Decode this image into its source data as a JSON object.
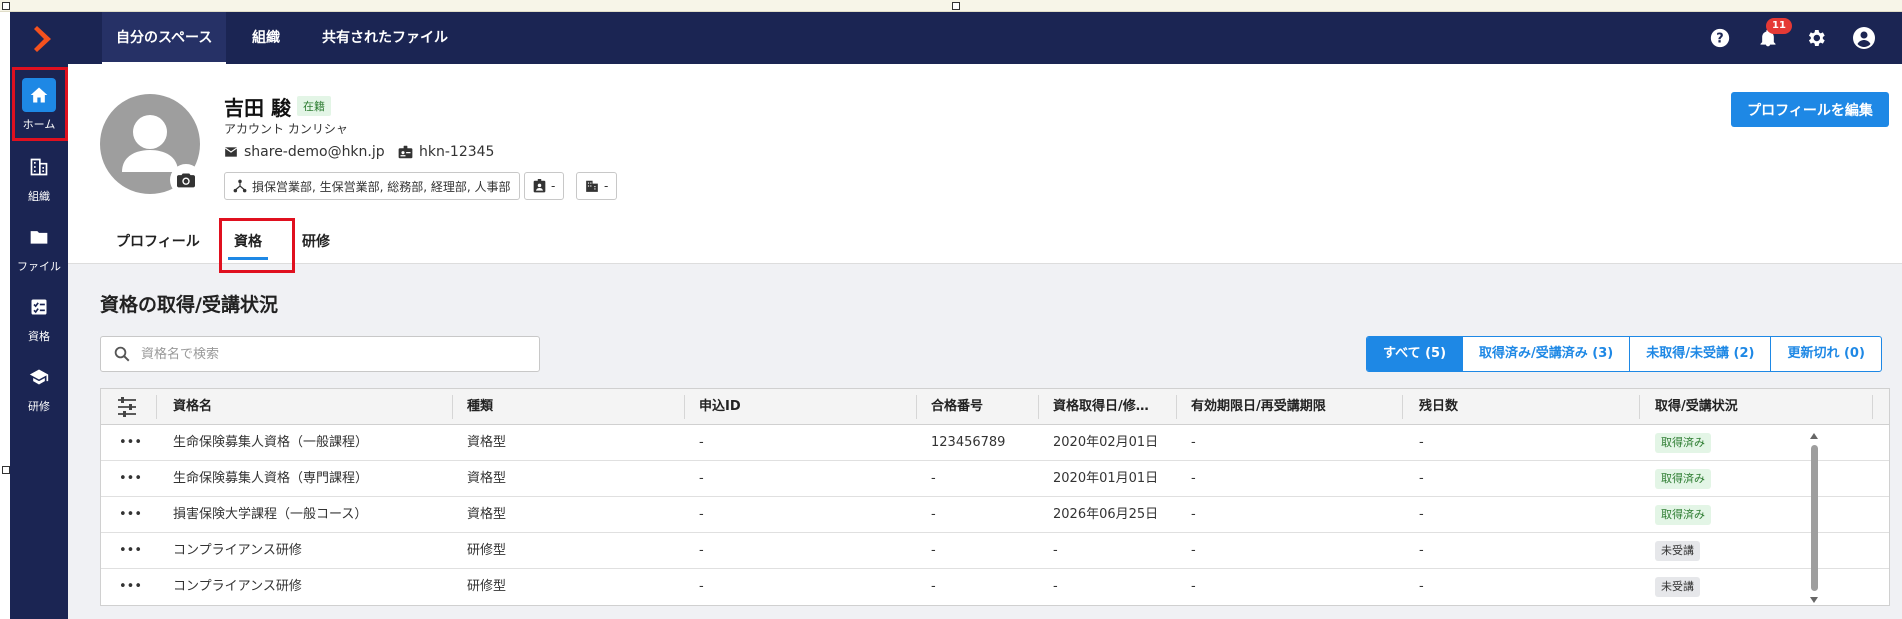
{
  "top_nav": {
    "tabs": [
      {
        "label": "自分のスペース"
      },
      {
        "label": "組織"
      },
      {
        "label": "共有されたファイル"
      }
    ],
    "notification_count": "11",
    "icons": [
      "help-icon",
      "bell-icon",
      "gear-icon",
      "account-icon"
    ]
  },
  "sidebar": {
    "items": [
      {
        "label": "ホーム",
        "icon": "home-icon"
      },
      {
        "label": "組織",
        "icon": "building-icon"
      },
      {
        "label": "ファイル",
        "icon": "folder-icon"
      },
      {
        "label": "資格",
        "icon": "certificate-icon"
      },
      {
        "label": "研修",
        "icon": "graduation-cap-icon"
      }
    ]
  },
  "profile": {
    "name": "吉田 駿",
    "status": "在籍",
    "kana": "アカウント カンリシャ",
    "email": "share-demo@hkn.jp",
    "employee_id": "hkn-12345",
    "departments": "損保営業部, 生保営業部, 総務部, 経理部, 人事部",
    "position": "-",
    "office": "-",
    "edit_button": "プロフィールを編集",
    "tabs": [
      {
        "label": "プロフィール"
      },
      {
        "label": "資格"
      },
      {
        "label": "研修"
      }
    ]
  },
  "qualifications": {
    "title": "資格の取得/受講状況",
    "search_placeholder": "資格名で検索",
    "filters": [
      {
        "label": "すべて (5)"
      },
      {
        "label": "取得済み/受講済み (3)"
      },
      {
        "label": "未取得/未受講 (2)"
      },
      {
        "label": "更新切れ (0)"
      }
    ],
    "columns": [
      "資格名",
      "種類",
      "申込ID",
      "合格番号",
      "資格取得日/修…",
      "有効期限日/再受講期限",
      "残日数",
      "取得/受講状況"
    ],
    "rows": [
      {
        "name": "生命保険募集人資格（一般課程）",
        "type": "資格型",
        "app_id": "-",
        "pass_no": "123456789",
        "acquired": "2020年02月01日",
        "expiry": "-",
        "days": "-",
        "status": "取得済み"
      },
      {
        "name": "生命保険募集人資格（専門課程）",
        "type": "資格型",
        "app_id": "-",
        "pass_no": "-",
        "acquired": "2020年01月01日",
        "expiry": "-",
        "days": "-",
        "status": "取得済み"
      },
      {
        "name": "損害保険大学課程（一般コース）",
        "type": "資格型",
        "app_id": "-",
        "pass_no": "-",
        "acquired": "2026年06月25日",
        "expiry": "-",
        "days": "-",
        "status": "取得済み"
      },
      {
        "name": "コンプライアンス研修",
        "type": "研修型",
        "app_id": "-",
        "pass_no": "-",
        "acquired": "-",
        "expiry": "-",
        "days": "-",
        "status": "未受講"
      },
      {
        "name": "コンプライアンス研修",
        "type": "研修型",
        "app_id": "-",
        "pass_no": "-",
        "acquired": "-",
        "expiry": "-",
        "days": "-",
        "status": "未受講"
      }
    ]
  },
  "colors": {
    "nav_bg": "#1b2553",
    "accent": "#1e88e5",
    "ok_tag": "#e3f5e6",
    "highlight": "#e0101f"
  }
}
